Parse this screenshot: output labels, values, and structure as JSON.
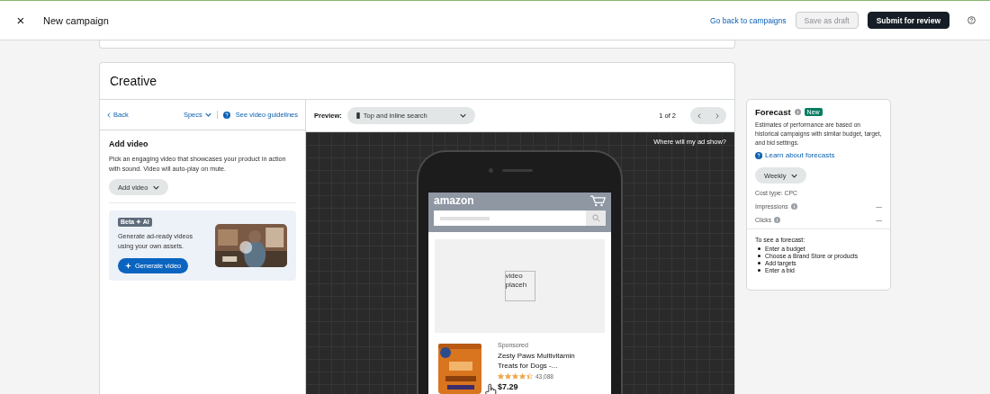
{
  "header": {
    "close": "×",
    "title": "New campaign",
    "back_link": "Go back to campaigns",
    "buttons": [
      {
        "label": "Save as draft",
        "kind": "secondary",
        "disabled": true
      },
      {
        "label": "Submit for review",
        "kind": "primary",
        "disabled": false
      }
    ]
  },
  "creative": {
    "title": "Creative",
    "toolbar": {
      "back": "Back",
      "specs": "Specs",
      "guidelines": "See video guidelines"
    },
    "add_video": {
      "heading": "Add video",
      "description": "Pick an engaging video that showcases your product in action with sound. Video will auto-play on mute.",
      "dropdown": "Add video"
    },
    "ai_promo": {
      "badge": "Beta ✦ AI",
      "text": "Generate ad-ready videos using your own assets.",
      "button": "Generate video"
    },
    "preview": {
      "label": "Preview:",
      "placement": "Top and inline search",
      "pager": "1 of 2",
      "where_link": "Where will my ad show?",
      "phone": {
        "logo": "amazon",
        "video_alt": "video placeh",
        "ad": {
          "sponsored": "Sponsored",
          "title": "Zesty Paws Multivitamin Treats for Dogs -...",
          "stars": 4.5,
          "reviews": "43,088",
          "price": "$7.29"
        }
      }
    }
  },
  "forecast": {
    "title": "Forecast",
    "badge": "New",
    "description": "Estimates of performance are based on historical campaigns with similar budget, target, and bid settings.",
    "learn_link": "Learn about forecasts",
    "period": "Weekly",
    "cost_type": "Cost type: CPC",
    "metrics": [
      {
        "label": "Impressions",
        "value": "—"
      },
      {
        "label": "Clicks",
        "value": "—"
      }
    ],
    "steps_heading": "To see a forecast:",
    "steps": [
      "Enter a budget",
      "Choose a Brand Store or products",
      "Add targets",
      "Enter a bid"
    ]
  }
}
